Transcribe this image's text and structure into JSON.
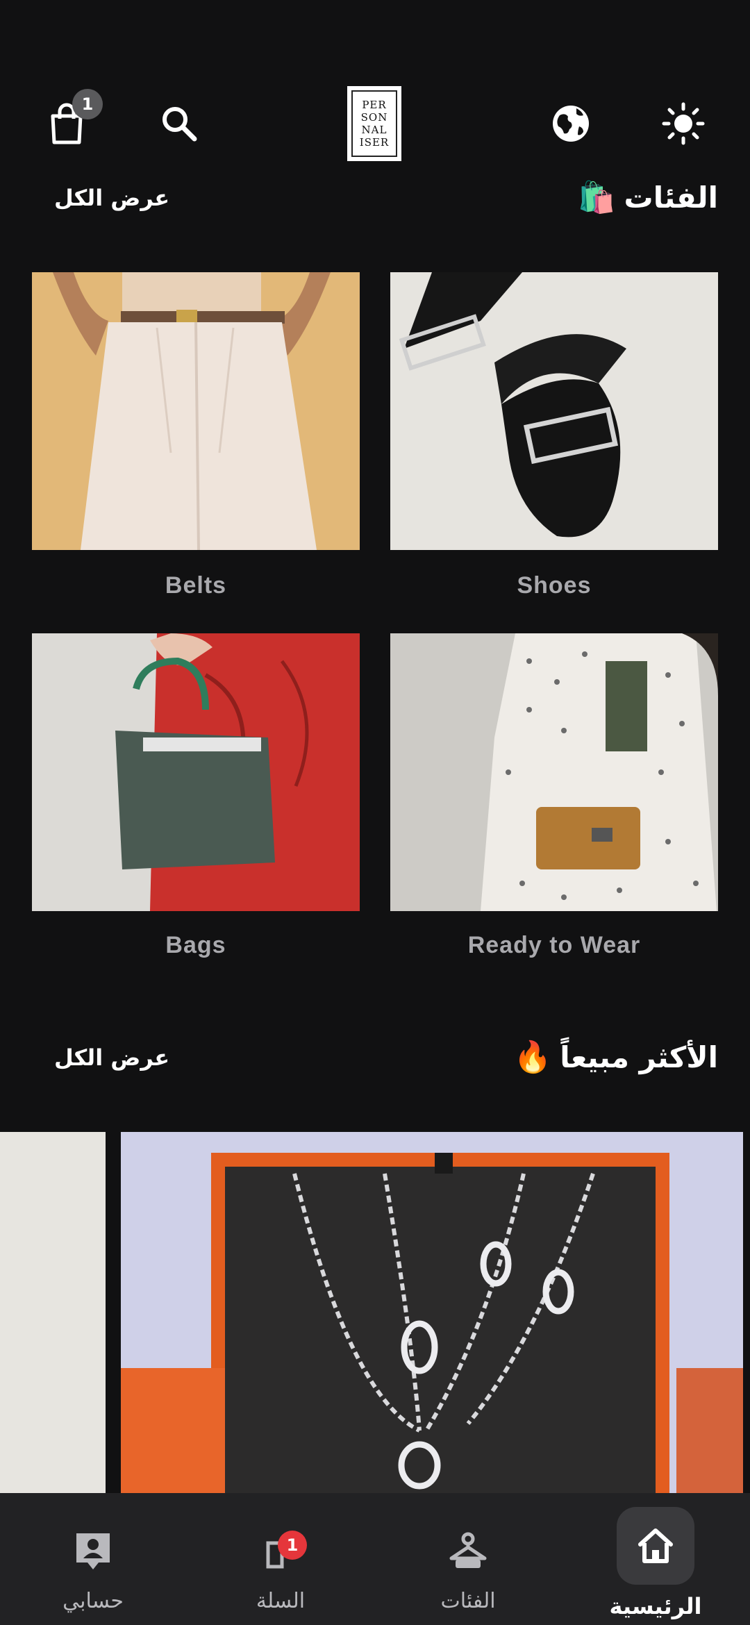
{
  "header": {
    "cart_count": "1",
    "logo_lines": [
      "PER",
      "SON",
      "NAL",
      "ISER"
    ],
    "icons": [
      "shopping-bag-icon",
      "search-icon",
      "globe-icon",
      "sun-icon"
    ]
  },
  "categories_section": {
    "title": "الفئات",
    "emoji": "🛍️",
    "view_all": "عرض الكل",
    "items": [
      {
        "label": "Shoes"
      },
      {
        "label": "Belts"
      },
      {
        "label": "Ready to Wear"
      },
      {
        "label": "Bags"
      }
    ]
  },
  "bestsellers_section": {
    "title": "الأكثر مبيعاً",
    "emoji": "🔥",
    "view_all": "عرض الكل"
  },
  "bottom_nav": {
    "items": [
      {
        "label": "الرئيسية",
        "icon": "home-icon",
        "active": true
      },
      {
        "label": "الفئات",
        "icon": "hanger-icon"
      },
      {
        "label": "السلة",
        "icon": "cart-icon",
        "badge": "1"
      },
      {
        "label": "حسابي",
        "icon": "account-icon"
      }
    ]
  },
  "colors": {
    "background": "#111112",
    "nav_background": "#222224",
    "badge_red": "#e5363b",
    "badge_gray": "#5a5a5c"
  }
}
